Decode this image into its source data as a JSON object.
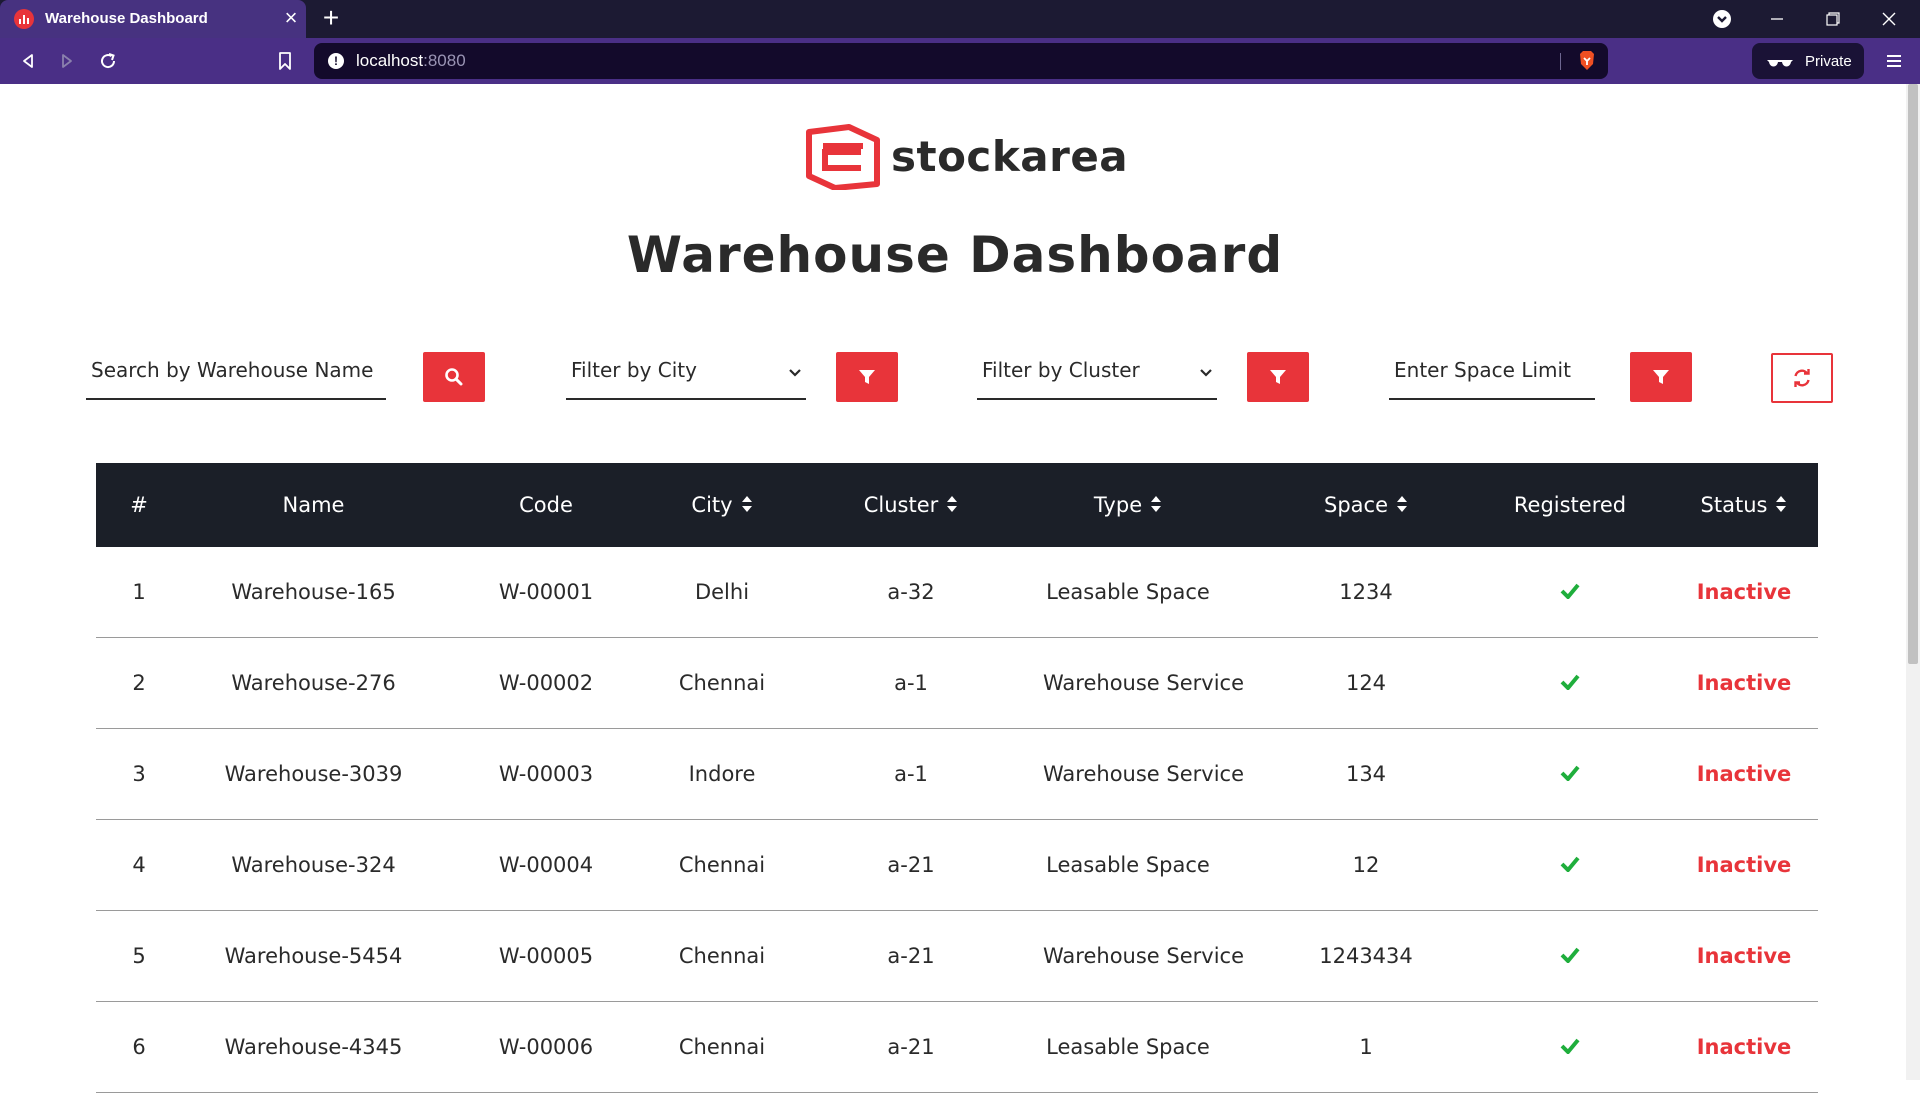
{
  "browser": {
    "tab_title": "Warehouse Dashboard",
    "tab_close": "×",
    "new_tab": "+",
    "url_host": "localhost",
    "url_port": ":8080",
    "private_label": "Private"
  },
  "page": {
    "logo_text": "stockarea",
    "title": "Warehouse Dashboard",
    "accent_color": "#e8343a",
    "controls": {
      "search_placeholder": "Search by Warehouse Name",
      "city_filter_placeholder": "Filter by City",
      "cluster_filter_placeholder": "Filter by Cluster",
      "space_limit_placeholder": "Enter Space Limit"
    },
    "table": {
      "headers": [
        "#",
        "Name",
        "Code",
        "City",
        "Cluster",
        "Type",
        "Space",
        "Registered",
        "Status"
      ],
      "rows": [
        {
          "num": "1",
          "name": "Warehouse-165",
          "code": "W-00001",
          "city": "Delhi",
          "cluster": "a-32",
          "type": "Leasable Space",
          "space": "1234",
          "registered": true,
          "status": "Inactive"
        },
        {
          "num": "2",
          "name": "Warehouse-276",
          "code": "W-00002",
          "city": "Chennai",
          "cluster": "a-1",
          "type": "Warehouse Service",
          "space": "124",
          "registered": true,
          "status": "Inactive"
        },
        {
          "num": "3",
          "name": "Warehouse-3039",
          "code": "W-00003",
          "city": "Indore",
          "cluster": "a-1",
          "type": "Warehouse Service",
          "space": "134",
          "registered": true,
          "status": "Inactive"
        },
        {
          "num": "4",
          "name": "Warehouse-324",
          "code": "W-00004",
          "city": "Chennai",
          "cluster": "a-21",
          "type": "Leasable Space",
          "space": "12",
          "registered": true,
          "status": "Inactive"
        },
        {
          "num": "5",
          "name": "Warehouse-5454",
          "code": "W-00005",
          "city": "Chennai",
          "cluster": "a-21",
          "type": "Warehouse Service",
          "space": "1243434",
          "registered": true,
          "status": "Inactive"
        },
        {
          "num": "6",
          "name": "Warehouse-4345",
          "code": "W-00006",
          "city": "Chennai",
          "cluster": "a-21",
          "type": "Leasable Space",
          "space": "1",
          "registered": true,
          "status": "Inactive"
        }
      ]
    }
  }
}
